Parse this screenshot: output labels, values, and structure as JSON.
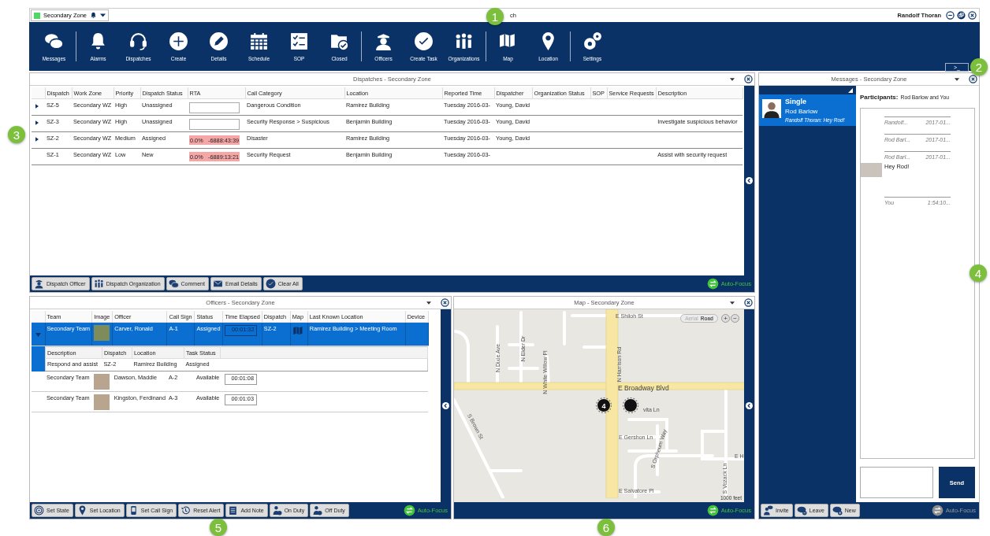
{
  "window": {
    "zone": "Secondary Zone",
    "title": "ch",
    "user": "Randolf Thoran"
  },
  "toolbar": [
    [
      {
        "label": "Messages"
      }
    ],
    [
      {
        "label": "Alarms"
      },
      {
        "label": "Dispatches"
      },
      {
        "label": "Create"
      },
      {
        "label": "Details"
      },
      {
        "label": "Schedule"
      },
      {
        "label": "SOP"
      },
      {
        "label": "Closed"
      }
    ],
    [
      {
        "label": "Officers"
      },
      {
        "label": "Create Task"
      },
      {
        "label": "Organizations"
      }
    ],
    [
      {
        "label": "Map"
      },
      {
        "label": "Location"
      }
    ],
    [
      {
        "label": "Settings"
      }
    ]
  ],
  "console_tab": ">_",
  "dispatches": {
    "title": "Dispatches - Secondary Zone",
    "columns": [
      "Dispatch",
      "Work Zone",
      "Priority",
      "Dispatch Status",
      "RTA",
      "Call Category",
      "Location",
      "Reported Time",
      "Dispatcher",
      "Organization Status",
      "SOP",
      "Service Requests",
      "Description"
    ],
    "rows": [
      {
        "expandable": true,
        "dispatch": "SZ-5",
        "work_zone": "Secondary WZ",
        "priority": "High",
        "dispatch_status": "Unassigned",
        "rta": {
          "kind": "empty"
        },
        "call_category": "Dangerous Condition",
        "location": "Ramirez Building",
        "reported_time": "Tuesday 2016-03-",
        "dispatcher": "Young, David"
      },
      {
        "expandable": true,
        "dispatch": "SZ-3",
        "work_zone": "Secondary WZ",
        "priority": "High",
        "dispatch_status": "Unassigned",
        "rta": {
          "kind": "empty"
        },
        "call_category": "Security Response > Suspicious",
        "location": "Benjamin Building",
        "reported_time": "Tuesday 2016-03-",
        "dispatcher": "Young, David",
        "description": "Investigate suspicious behavior"
      },
      {
        "expandable": true,
        "dispatch": "SZ-2",
        "work_zone": "Secondary WZ",
        "priority": "Medium",
        "dispatch_status": "Assigned",
        "rta": {
          "kind": "timer",
          "percent": "0.0%",
          "time": "-6888:43:39"
        },
        "call_category": "Disaster",
        "location": "Ramirez Building",
        "reported_time": "Tuesday 2016-03-",
        "dispatcher": "Young, David"
      },
      {
        "expandable": false,
        "dispatch": "SZ-1",
        "work_zone": "Secondary WZ",
        "priority": "Low",
        "dispatch_status": "New",
        "rta": {
          "kind": "timer",
          "percent": "0.0%",
          "time": "-6889:13:21"
        },
        "call_category": "Security Request",
        "location": "Benjamin Building",
        "reported_time": "Tuesday 2016-03-",
        "description": "Assist with security request"
      }
    ],
    "buttons": [
      "Dispatch Officer",
      "Dispatch Organization",
      "Comment",
      "Email Details",
      "Clear All"
    ],
    "auto_focus": {
      "label": "Auto-Focus",
      "on": true
    }
  },
  "officers": {
    "title": "Officers - Secondary Zone",
    "columns": [
      "Team",
      "Image",
      "Officer",
      "Call Sign",
      "Status",
      "Time Elapsed",
      "Dispatch",
      "Map",
      "Last Known Location",
      "Device"
    ],
    "rows": [
      {
        "selected": true,
        "team": "Secondary Team",
        "officer": "Carver, Ronald",
        "call_sign": "A-1",
        "status": "Assigned",
        "time_elapsed": "00:01:32",
        "dispatch": "SZ-2",
        "map_icon": true,
        "last_known_location": "Ramirez Building > Meeting Room",
        "details": {
          "columns": [
            "Description",
            "Dispatch",
            "Location",
            "Task Status"
          ],
          "rows": [
            [
              "Respond and assist",
              "SZ-2",
              "Ramirez Building",
              "Assigned"
            ]
          ]
        }
      },
      {
        "selected": false,
        "team": "Secondary Team",
        "officer": "Dawson, Maddie",
        "call_sign": "A-2",
        "status": "Available",
        "time_elapsed": "00:01:08",
        "map_icon": false
      },
      {
        "selected": false,
        "team": "Secondary Team",
        "officer": "Kingston, Ferdinand",
        "call_sign": "A-3",
        "status": "Available",
        "time_elapsed": "00:01:03",
        "map_icon": false
      }
    ],
    "buttons": [
      "Set State",
      "Set Location",
      "Set Call Sign",
      "Reset Alert",
      "Add Note",
      "On Duty",
      "Off Duty"
    ],
    "auto_focus": {
      "label": "Auto-Focus",
      "on": true
    }
  },
  "map": {
    "title": "Map - Secondary Zone",
    "streets": [
      "E Shiloh St",
      "N Dixie Ave",
      "N Elder Dr",
      "N White Willow Pl",
      "N Harrison Rd",
      "E Broadway Blvd",
      "vita Ln",
      "S Orpheum Way",
      "E Gershon Ln",
      "S Vozack Ln",
      "E H",
      "S Brown St",
      "E Salvatore Pl"
    ],
    "markers": [
      {
        "kind": "cluster",
        "label": "4"
      },
      {
        "kind": "single"
      }
    ],
    "layers": [
      {
        "label": "Aerial",
        "selected": false
      },
      {
        "label": "Road",
        "selected": true
      }
    ],
    "zoom": [
      "+",
      "−"
    ],
    "scale": "1000 feet",
    "auto_focus": {
      "label": "Auto-Focus",
      "on": true
    }
  },
  "messages": {
    "title": "Messages - Secondary Zone",
    "conversations": [
      {
        "selected": true,
        "type": "Single",
        "name": "Rod Barlow",
        "preview": "Randolf Thoran: Hey Rod!"
      }
    ],
    "participants_label": "Participants:",
    "participants": "Rod Barlow and You",
    "entries": [
      {
        "sender": "Randolf...",
        "time": "2017-01..."
      },
      {
        "sender": "Rod Barl...",
        "time": "2017-01..."
      },
      {
        "sender": "Rod Barl...",
        "time": "2017-01...",
        "text": "Hey Rod!"
      },
      {
        "sender": "You",
        "time": "1:54:10..."
      }
    ],
    "send": "Send",
    "buttons": [
      "Invite",
      "Leave",
      "New"
    ],
    "auto_focus": {
      "label": "Auto-Focus",
      "on": false
    }
  },
  "callouts": [
    {
      "label": "1"
    },
    {
      "label": "2"
    },
    {
      "label": "3"
    },
    {
      "label": "4"
    },
    {
      "label": "5"
    },
    {
      "label": "6"
    }
  ]
}
